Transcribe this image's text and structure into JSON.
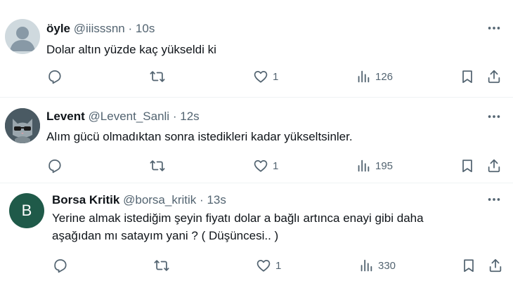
{
  "tweets": [
    {
      "name": "öyle",
      "handle": "@iiisssnn",
      "dot": "·",
      "time": "10s",
      "lines": [
        "Dolar altın yüzde kaç yükseldi ki"
      ],
      "likes": "1",
      "views": "126",
      "avatar": "default-avatar"
    },
    {
      "name": "Levent",
      "handle": "@Levent_Sanli",
      "dot": "·",
      "time": "12s",
      "lines": [
        "Alım gücü olmadıktan sonra istedikleri kadar yükseltsinler."
      ],
      "likes": "1",
      "views": "195",
      "avatar": "cat-avatar"
    },
    {
      "name": "Borsa Kritik",
      "handle": "@borsa_kritik",
      "dot": "·",
      "time": "13s",
      "lines": [
        "Yerine almak istediğim şeyin fiyatı dolar a bağlı artınca enayi gibi daha",
        "aşağıdan mı satayım yani ? ( Düşüncesi.. )"
      ],
      "likes": "1",
      "views": "330",
      "avatar_letter": "B",
      "avatar_color": "#1f5a49"
    }
  ],
  "icons": [
    "reply-icon",
    "retweet-icon",
    "like-icon",
    "views-icon",
    "bookmark-icon",
    "share-icon",
    "more-icon"
  ]
}
